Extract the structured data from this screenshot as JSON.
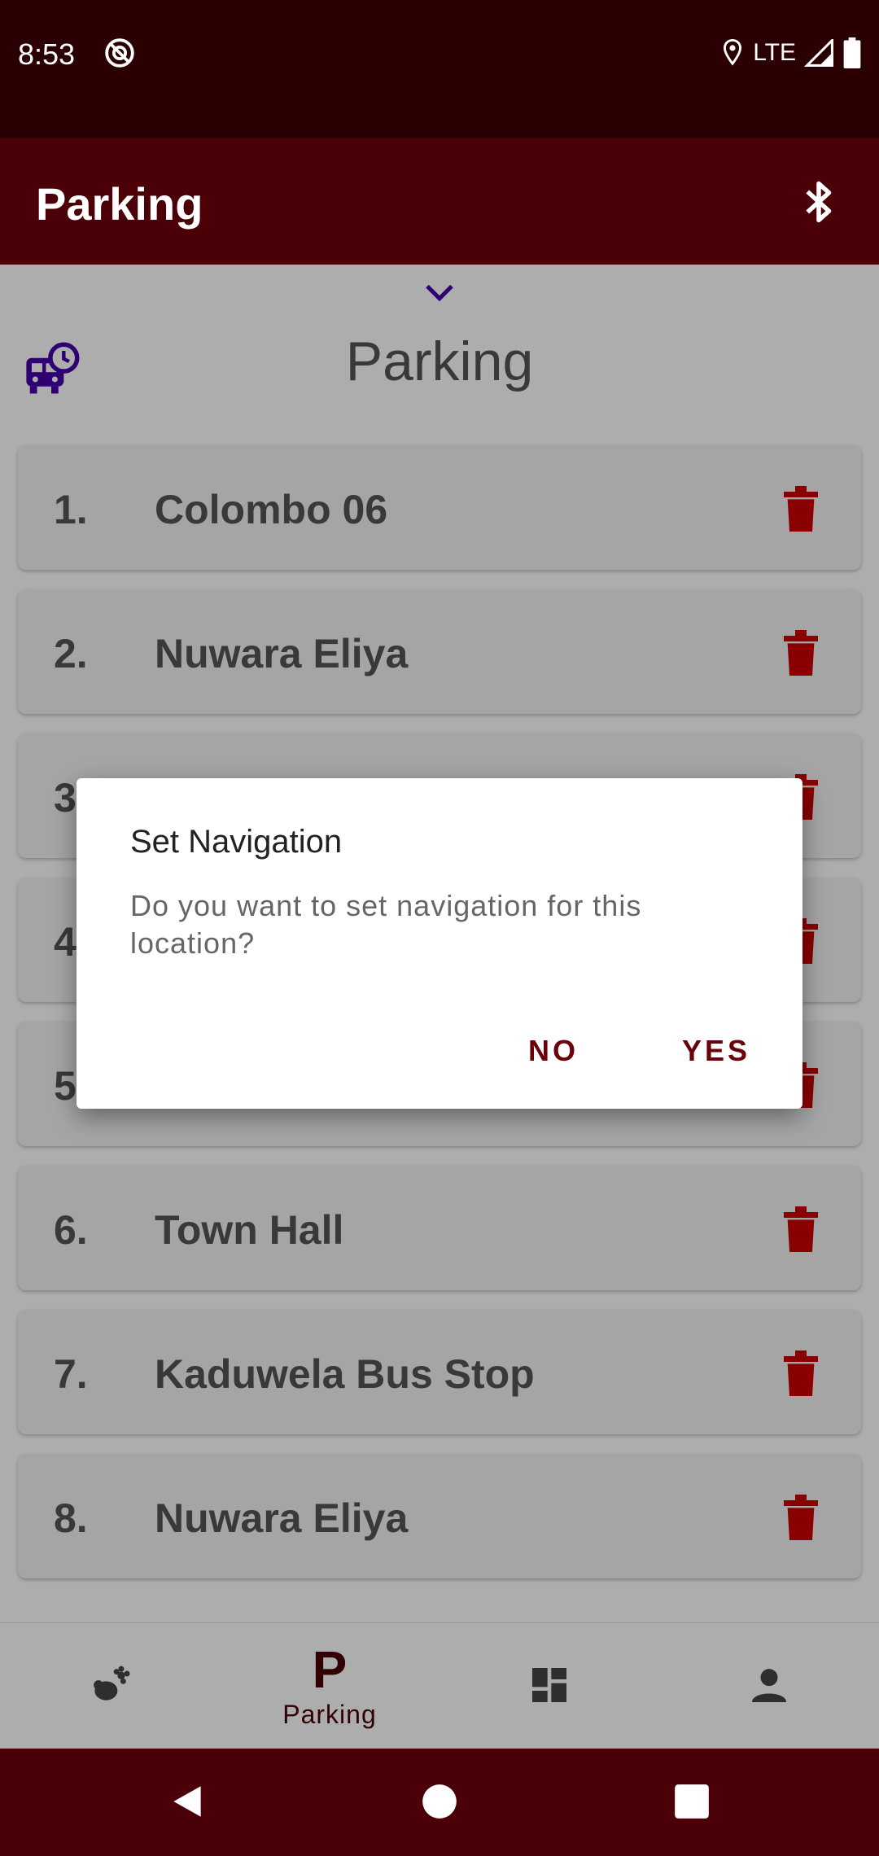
{
  "status_bar": {
    "time": "8:53",
    "network": "LTE"
  },
  "app_bar": {
    "title": "Parking"
  },
  "page": {
    "title": "Parking"
  },
  "parking_list": [
    {
      "number": "1.",
      "name": "Colombo 06"
    },
    {
      "number": "2.",
      "name": "Nuwara Eliya"
    },
    {
      "number": "3.",
      "name": ""
    },
    {
      "number": "4.",
      "name": ""
    },
    {
      "number": "5.",
      "name": ""
    },
    {
      "number": "6.",
      "name": "Town Hall"
    },
    {
      "number": "7.",
      "name": "Kaduwela Bus Stop"
    },
    {
      "number": "8.",
      "name": "Nuwara Eliya"
    }
  ],
  "dialog": {
    "title": "Set Navigation",
    "message": "Do you want to set navigation for this location?",
    "no_label": "NO",
    "yes_label": "YES"
  },
  "bottom_nav": {
    "parking_letter": "P",
    "parking_label": "Parking"
  },
  "colors": {
    "app_bar": "#4a0006",
    "status_bar": "#2a0003",
    "accent": "#6a0008",
    "trash": "#cc0000",
    "icon_purple": "#4400aa"
  }
}
